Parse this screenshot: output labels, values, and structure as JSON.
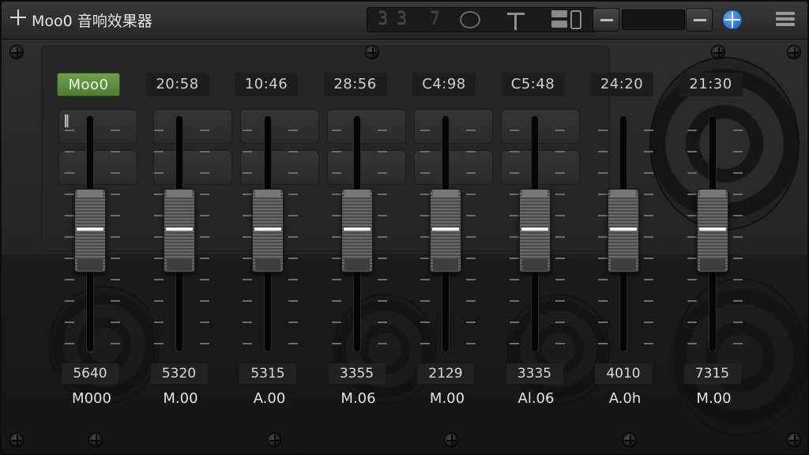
{
  "window": {
    "title": "Moo0 音响效果器",
    "toolbar": {
      "digits": [
        "3",
        "3",
        "7"
      ],
      "icons": [
        "plus-icon",
        "eye-icon",
        "crosshair-icon",
        "stack-icon",
        "bar-icon",
        "minus-icon",
        "minus-icon",
        "globe-icon",
        "menu-icon"
      ]
    }
  },
  "channels": [
    {
      "display": "Moo0",
      "value": "5640",
      "label": "M000",
      "level": 0.5,
      "active": true
    },
    {
      "display": "20:58",
      "value": "5320",
      "label": "M.00",
      "level": 0.5
    },
    {
      "display": "10:46",
      "value": "5315",
      "label": "A.00",
      "level": 0.5
    },
    {
      "display": "28:56",
      "value": "3355",
      "label": "M.06",
      "level": 0.5
    },
    {
      "display": "C4:98",
      "value": "2129",
      "label": "M.00",
      "level": 0.5
    },
    {
      "display": "C5:48",
      "value": "3335",
      "label": "Al.06",
      "level": 0.5
    },
    {
      "display": "24:20",
      "value": "4010",
      "label": "A.0h",
      "level": 0.5
    },
    {
      "display": "21:30",
      "value": "7315",
      "label": "M.00",
      "level": 0.5
    }
  ],
  "colors": {
    "accent_green": "#5f913f",
    "globe_blue": "#2d6fc0"
  }
}
